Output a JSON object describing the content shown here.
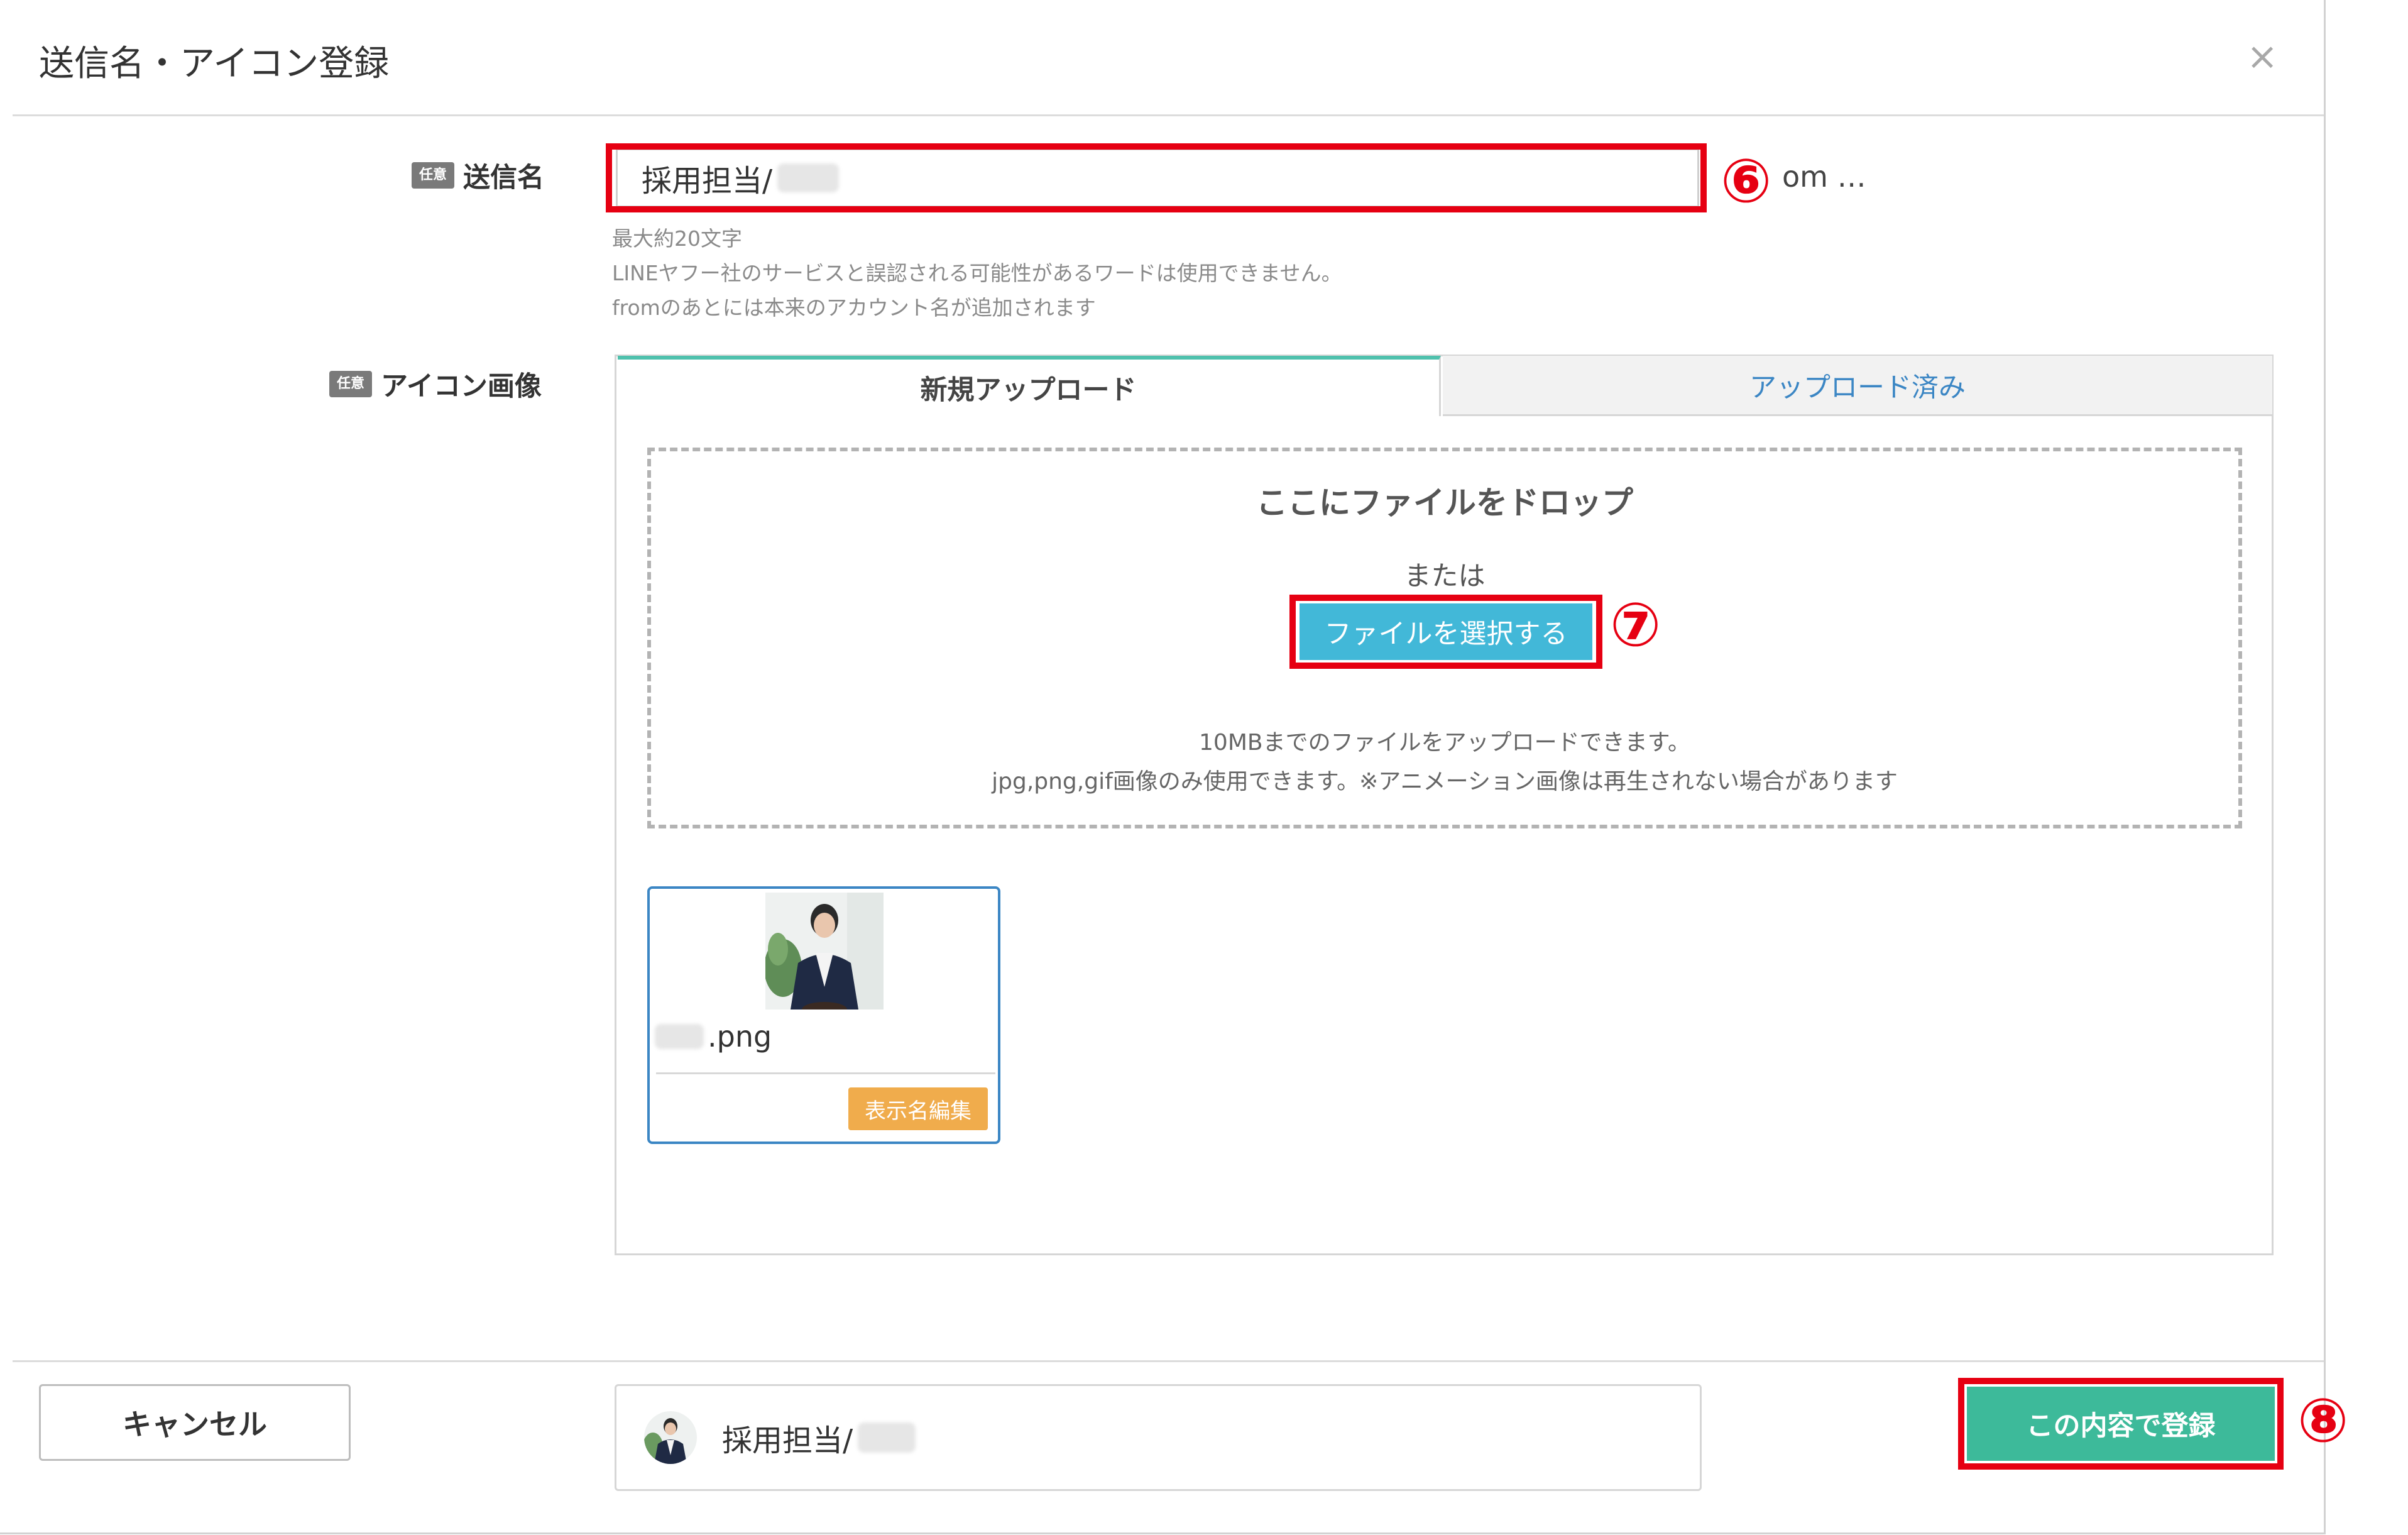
{
  "dialog": {
    "title": "送信名・アイコン登録",
    "close_symbol": "×"
  },
  "sender": {
    "badge": "任意",
    "label": "送信名",
    "value": "採用担当/",
    "suffix": "om …",
    "help": [
      "最大約20文字",
      "LINEヤフー社のサービスと誤認される可能性があるワードは使用できません。",
      "fromのあとには本来のアカウント名が追加されます"
    ]
  },
  "icon_image": {
    "badge": "任意",
    "label": "アイコン画像",
    "tabs": [
      {
        "label": "新規アップロード",
        "active": true
      },
      {
        "label": "アップロード済み",
        "active": false
      }
    ],
    "dropzone": {
      "title": "ここにファイルをドロップ",
      "or": "または",
      "select_button": "ファイルを選択する",
      "note1": "10MBまでのファイルをアップロードできます。",
      "note2": "jpg,png,gif画像のみ使用できます。※アニメーション画像は再生されない場合があります"
    },
    "uploaded": {
      "filename": ".png",
      "edit_button": "表示名編集"
    }
  },
  "footer": {
    "cancel": "キャンセル",
    "preview_name": "採用担当/",
    "submit": "この内容で登録"
  },
  "markers": {
    "m6": "⑥",
    "m7": "⑦",
    "m8": "⑧"
  },
  "colors": {
    "highlight": "#e60012",
    "tab_accent": "#4fc1ad",
    "select_button": "#42b8d8",
    "edit_button": "#f0ac4c",
    "submit_button": "#3dba9a",
    "link_blue": "#3b86c4"
  }
}
